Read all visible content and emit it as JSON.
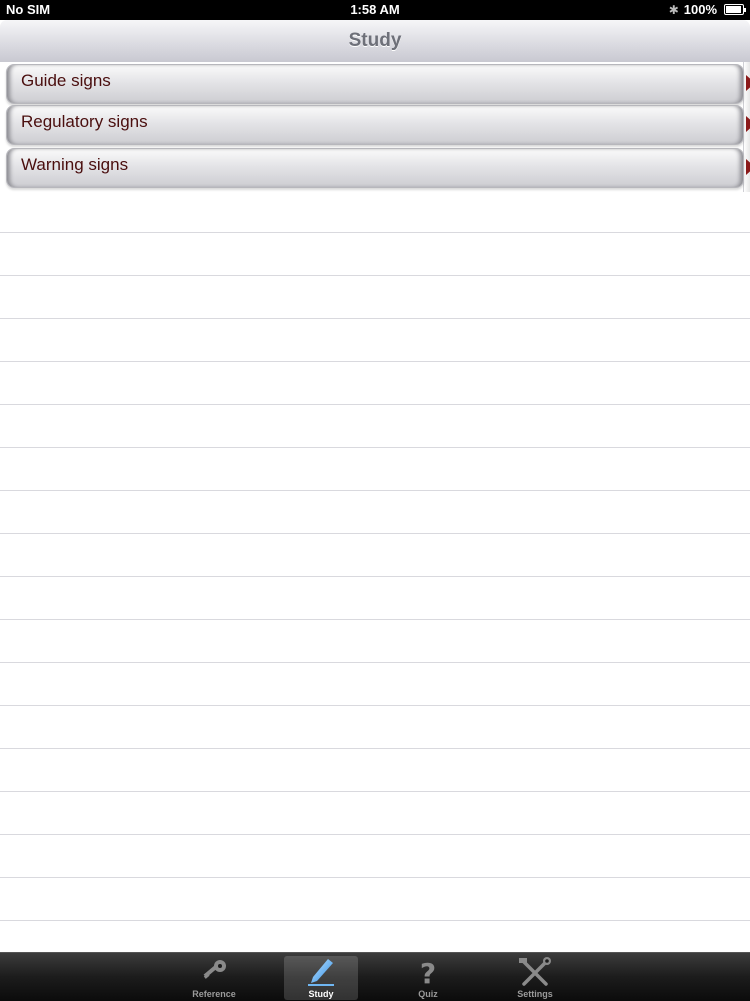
{
  "status_bar": {
    "carrier": "No SIM",
    "time": "1:58 AM",
    "battery": "100%"
  },
  "nav": {
    "title": "Study"
  },
  "menu": {
    "items": [
      {
        "label": "Guide signs"
      },
      {
        "label": "Regulatory signs"
      },
      {
        "label": "Warning signs"
      }
    ]
  },
  "tabs": [
    {
      "label": "Reference",
      "icon": "key-icon"
    },
    {
      "label": "Study",
      "icon": "pencil-icon",
      "selected": true
    },
    {
      "label": "Quiz",
      "icon": "question-mark-icon"
    },
    {
      "label": "Settings",
      "icon": "tools-icon"
    }
  ],
  "colors": {
    "row_text": "#4a0e0e",
    "chevron": "#8b1a1a",
    "nav_title": "#6e7079"
  }
}
